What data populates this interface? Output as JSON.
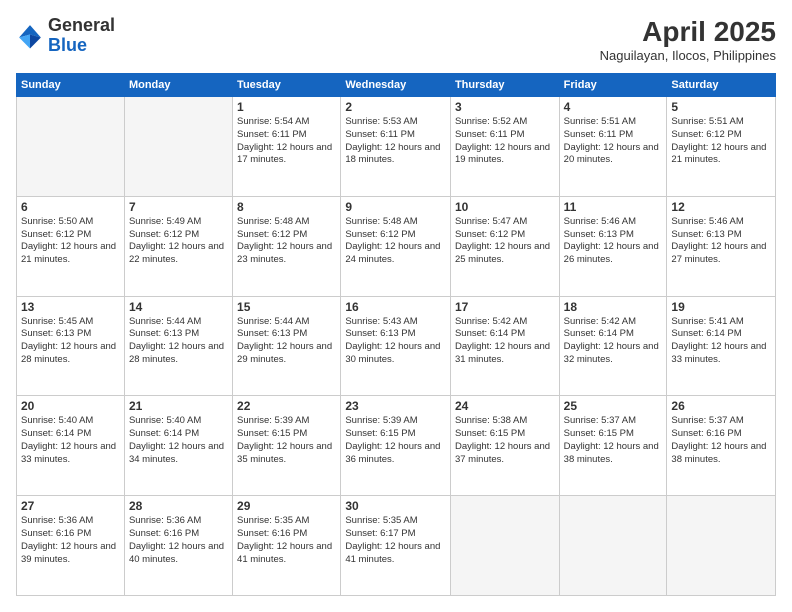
{
  "logo": {
    "general": "General",
    "blue": "Blue"
  },
  "header": {
    "month": "April 2025",
    "location": "Naguilayan, Ilocos, Philippines"
  },
  "weekdays": [
    "Sunday",
    "Monday",
    "Tuesday",
    "Wednesday",
    "Thursday",
    "Friday",
    "Saturday"
  ],
  "weeks": [
    [
      {
        "day": "",
        "detail": ""
      },
      {
        "day": "",
        "detail": ""
      },
      {
        "day": "1",
        "detail": "Sunrise: 5:54 AM\nSunset: 6:11 PM\nDaylight: 12 hours and 17 minutes."
      },
      {
        "day": "2",
        "detail": "Sunrise: 5:53 AM\nSunset: 6:11 PM\nDaylight: 12 hours and 18 minutes."
      },
      {
        "day": "3",
        "detail": "Sunrise: 5:52 AM\nSunset: 6:11 PM\nDaylight: 12 hours and 19 minutes."
      },
      {
        "day": "4",
        "detail": "Sunrise: 5:51 AM\nSunset: 6:11 PM\nDaylight: 12 hours and 20 minutes."
      },
      {
        "day": "5",
        "detail": "Sunrise: 5:51 AM\nSunset: 6:12 PM\nDaylight: 12 hours and 21 minutes."
      }
    ],
    [
      {
        "day": "6",
        "detail": "Sunrise: 5:50 AM\nSunset: 6:12 PM\nDaylight: 12 hours and 21 minutes."
      },
      {
        "day": "7",
        "detail": "Sunrise: 5:49 AM\nSunset: 6:12 PM\nDaylight: 12 hours and 22 minutes."
      },
      {
        "day": "8",
        "detail": "Sunrise: 5:48 AM\nSunset: 6:12 PM\nDaylight: 12 hours and 23 minutes."
      },
      {
        "day": "9",
        "detail": "Sunrise: 5:48 AM\nSunset: 6:12 PM\nDaylight: 12 hours and 24 minutes."
      },
      {
        "day": "10",
        "detail": "Sunrise: 5:47 AM\nSunset: 6:12 PM\nDaylight: 12 hours and 25 minutes."
      },
      {
        "day": "11",
        "detail": "Sunrise: 5:46 AM\nSunset: 6:13 PM\nDaylight: 12 hours and 26 minutes."
      },
      {
        "day": "12",
        "detail": "Sunrise: 5:46 AM\nSunset: 6:13 PM\nDaylight: 12 hours and 27 minutes."
      }
    ],
    [
      {
        "day": "13",
        "detail": "Sunrise: 5:45 AM\nSunset: 6:13 PM\nDaylight: 12 hours and 28 minutes."
      },
      {
        "day": "14",
        "detail": "Sunrise: 5:44 AM\nSunset: 6:13 PM\nDaylight: 12 hours and 28 minutes."
      },
      {
        "day": "15",
        "detail": "Sunrise: 5:44 AM\nSunset: 6:13 PM\nDaylight: 12 hours and 29 minutes."
      },
      {
        "day": "16",
        "detail": "Sunrise: 5:43 AM\nSunset: 6:13 PM\nDaylight: 12 hours and 30 minutes."
      },
      {
        "day": "17",
        "detail": "Sunrise: 5:42 AM\nSunset: 6:14 PM\nDaylight: 12 hours and 31 minutes."
      },
      {
        "day": "18",
        "detail": "Sunrise: 5:42 AM\nSunset: 6:14 PM\nDaylight: 12 hours and 32 minutes."
      },
      {
        "day": "19",
        "detail": "Sunrise: 5:41 AM\nSunset: 6:14 PM\nDaylight: 12 hours and 33 minutes."
      }
    ],
    [
      {
        "day": "20",
        "detail": "Sunrise: 5:40 AM\nSunset: 6:14 PM\nDaylight: 12 hours and 33 minutes."
      },
      {
        "day": "21",
        "detail": "Sunrise: 5:40 AM\nSunset: 6:14 PM\nDaylight: 12 hours and 34 minutes."
      },
      {
        "day": "22",
        "detail": "Sunrise: 5:39 AM\nSunset: 6:15 PM\nDaylight: 12 hours and 35 minutes."
      },
      {
        "day": "23",
        "detail": "Sunrise: 5:39 AM\nSunset: 6:15 PM\nDaylight: 12 hours and 36 minutes."
      },
      {
        "day": "24",
        "detail": "Sunrise: 5:38 AM\nSunset: 6:15 PM\nDaylight: 12 hours and 37 minutes."
      },
      {
        "day": "25",
        "detail": "Sunrise: 5:37 AM\nSunset: 6:15 PM\nDaylight: 12 hours and 38 minutes."
      },
      {
        "day": "26",
        "detail": "Sunrise: 5:37 AM\nSunset: 6:16 PM\nDaylight: 12 hours and 38 minutes."
      }
    ],
    [
      {
        "day": "27",
        "detail": "Sunrise: 5:36 AM\nSunset: 6:16 PM\nDaylight: 12 hours and 39 minutes."
      },
      {
        "day": "28",
        "detail": "Sunrise: 5:36 AM\nSunset: 6:16 PM\nDaylight: 12 hours and 40 minutes."
      },
      {
        "day": "29",
        "detail": "Sunrise: 5:35 AM\nSunset: 6:16 PM\nDaylight: 12 hours and 41 minutes."
      },
      {
        "day": "30",
        "detail": "Sunrise: 5:35 AM\nSunset: 6:17 PM\nDaylight: 12 hours and 41 minutes."
      },
      {
        "day": "",
        "detail": ""
      },
      {
        "day": "",
        "detail": ""
      },
      {
        "day": "",
        "detail": ""
      }
    ]
  ]
}
